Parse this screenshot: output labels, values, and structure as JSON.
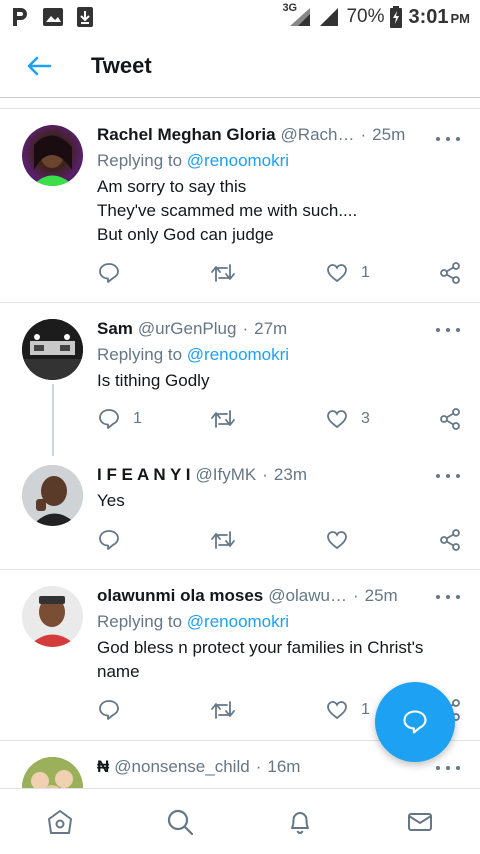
{
  "status_bar": {
    "network": "3G",
    "battery": "70%",
    "time": "3:01",
    "meridiem": "PM"
  },
  "header": {
    "title": "Tweet"
  },
  "tweets": [
    {
      "name": "Rachel Meghan Gloria",
      "handle": "@Rach…",
      "separator": "·",
      "time": "25m",
      "replying_prefix": "Replying to ",
      "replying_to": "@renoomokri",
      "lines": [
        "Am sorry to say this",
        "They've scammed me with such....",
        "But only God can judge"
      ],
      "likes": "1"
    },
    {
      "name": "Sam",
      "handle": "@urGenPlug",
      "separator": "·",
      "time": "27m",
      "replying_prefix": "Replying to ",
      "replying_to": "@renoomokri",
      "lines": [
        "Is tithing Godly"
      ],
      "replies": "1",
      "likes": "3"
    },
    {
      "name": "I F E A N Y I",
      "handle": "@IfyMK",
      "separator": "·",
      "time": "23m",
      "lines": [
        "Yes"
      ]
    },
    {
      "name": "olawunmi ola moses",
      "handle": "@olawu…",
      "separator": "·",
      "time": "25m",
      "replying_prefix": "Replying to ",
      "replying_to": "@renoomokri",
      "lines": [
        "God bless n protect your families in Christ's",
        "name"
      ],
      "likes": "1"
    },
    {
      "name": "₦",
      "handle": "@nonsense_child",
      "separator": "·",
      "time": "16m"
    }
  ]
}
